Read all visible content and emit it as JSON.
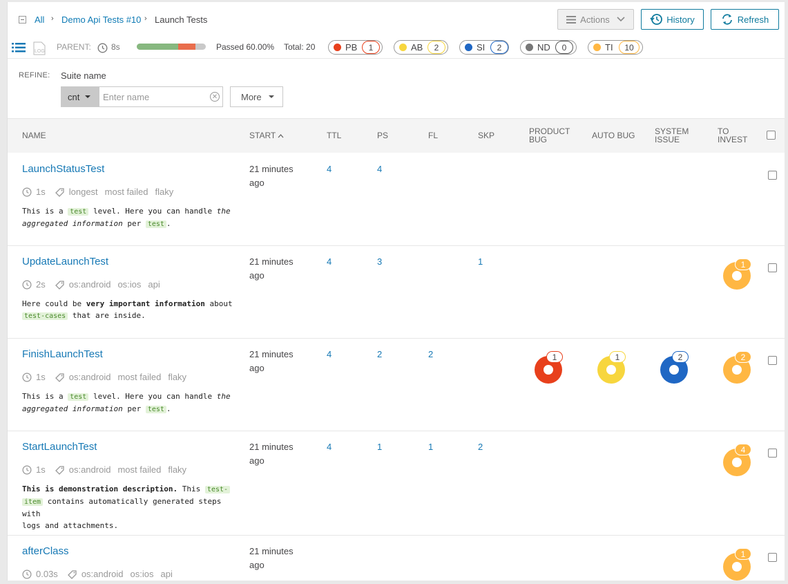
{
  "breadcrumb": {
    "all": "All",
    "launch": "Demo Api Tests #10",
    "current": "Launch Tests"
  },
  "toolbar": {
    "actions_label": "Actions",
    "history_label": "History",
    "refresh_label": "Refresh"
  },
  "stats": {
    "parent_label": "PARENT:",
    "duration": "8s",
    "passed_fraction": 0.6,
    "failed_fraction": 0.25,
    "passed_text": "Passed 60.00%",
    "total_text": "Total: 20",
    "defects": [
      {
        "code": "PB",
        "count": "1",
        "color": "#e8401c"
      },
      {
        "code": "AB",
        "count": "2",
        "color": "#f7d63e"
      },
      {
        "code": "SI",
        "count": "2",
        "color": "#1f67c4"
      },
      {
        "code": "ND",
        "count": "0",
        "color": "#777777"
      },
      {
        "code": "TI",
        "count": "10",
        "color": "#ffb743"
      }
    ]
  },
  "refine": {
    "label": "REFINE:",
    "filter_name": "Suite name",
    "condition": "cnt",
    "input_placeholder": "Enter name",
    "more_label": "More"
  },
  "columns": {
    "name": "NAME",
    "start": "START",
    "ttl": "TTL",
    "ps": "PS",
    "fl": "FL",
    "skp": "SKP",
    "product_bug_1": "PRODUCT",
    "product_bug_2": "BUG",
    "auto_bug": "AUTO BUG",
    "system_issue_1": "SYSTEM",
    "system_issue_2": "ISSUE",
    "to_invest_1": "TO",
    "to_invest_2": "INVEST"
  },
  "rows": [
    {
      "name": "LaunchStatusTest",
      "start_1": "21 minutes",
      "start_2": "ago",
      "ttl": "4",
      "ps": "4",
      "fl": "",
      "skp": "",
      "duration": "1s",
      "attrs": [
        "longest",
        "most failed",
        "flaky"
      ]
    },
    {
      "name": "UpdateLaunchTest",
      "start_1": "21 minutes",
      "start_2": "ago",
      "ttl": "4",
      "ps": "3",
      "fl": "",
      "skp": "1",
      "duration": "2s",
      "attrs": [
        "os:android",
        "os:ios",
        "api"
      ],
      "ti": "1"
    },
    {
      "name": "FinishLaunchTest",
      "start_1": "21 minutes",
      "start_2": "ago",
      "ttl": "4",
      "ps": "2",
      "fl": "2",
      "skp": "",
      "duration": "1s",
      "attrs": [
        "os:android",
        "most failed",
        "flaky"
      ],
      "pb": "1",
      "ab": "1",
      "si": "2",
      "ti": "2"
    },
    {
      "name": "StartLaunchTest",
      "start_1": "21 minutes",
      "start_2": "ago",
      "ttl": "4",
      "ps": "1",
      "fl": "1",
      "skp": "2",
      "duration": "1s",
      "attrs": [
        "os:android",
        "most failed",
        "flaky"
      ],
      "ti": "4"
    },
    {
      "name": "afterClass",
      "start_1": "21 minutes",
      "start_2": "ago",
      "ttl": "",
      "ps": "",
      "fl": "",
      "skp": "",
      "duration": "0.03s",
      "attrs": [
        "os:android",
        "os:ios",
        "api"
      ],
      "ti": "1"
    }
  ],
  "descriptions": {
    "d1": {
      "a": "This is a ",
      "b": "test",
      "c": " level. Here you can handle ",
      "d": "the",
      "e": "aggregated information",
      "f": " per ",
      "g": "test",
      "h": "."
    },
    "d2": {
      "a": "Here could be ",
      "b": "very important information",
      "c": " about",
      "d": "test-cases",
      "e": " that are inside."
    },
    "d4": {
      "a": "This is demonstration description.",
      "b": " This ",
      "c": "test-",
      "d": "item",
      "e": " contains automatically generated steps with",
      "f": "logs and attachments."
    }
  }
}
